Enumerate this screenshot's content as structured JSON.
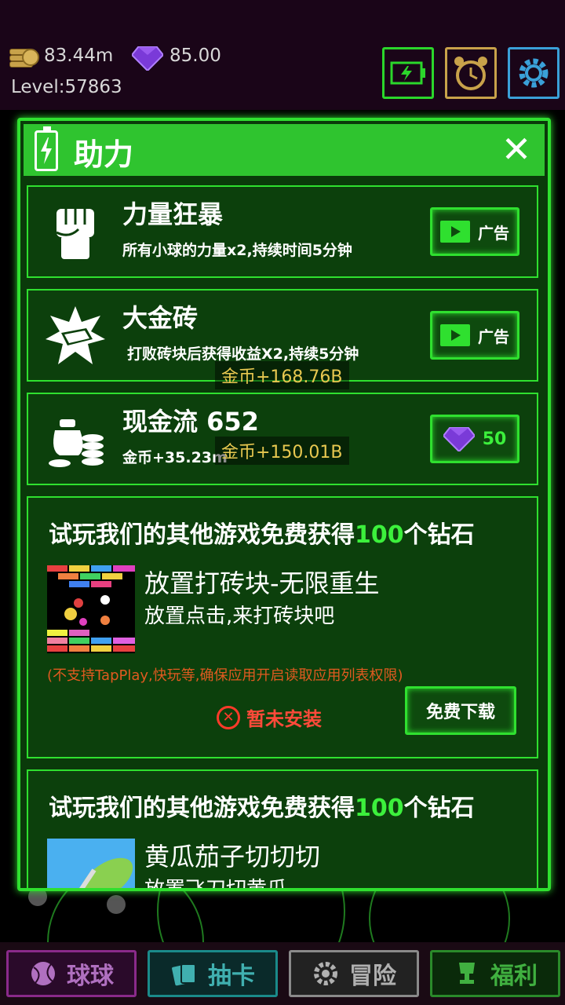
{
  "hud": {
    "coins": "83.44m",
    "gems": "85.00",
    "level": "Level:57863",
    "buttons": [
      "battery-icon",
      "alarm-clock-icon",
      "gear-icon"
    ]
  },
  "panel": {
    "title": "助力",
    "close_icon": "close-icon",
    "boosts": [
      {
        "title": "力量狂暴",
        "desc": "所有小球的力量x2,持续时间5分钟",
        "action_label": "广告",
        "icon": "fist-icon"
      },
      {
        "title": "大金砖",
        "desc": "打败砖块后获得收益X2,持续5分钟",
        "action_label": "广告",
        "icon": "gold-brick-icon"
      },
      {
        "title": "现金流 652",
        "desc": "金币+35.23m",
        "price": "50",
        "icon": "money-bag-icon"
      }
    ],
    "floating": [
      "金币+168.76B",
      "金币+150.01B"
    ],
    "promos": [
      {
        "head_pre": "试玩我们的其他游戏免费获得",
        "head_num": "100",
        "head_post": "个钻石",
        "game_name": "放置打砖块-无限重生",
        "game_sub": "放置点击,来打砖块吧",
        "note": "(不支持TapPlay,快玩等,确保应用开启读取应用列表权限)",
        "status": "暂未安装",
        "download_label": "免费下载"
      },
      {
        "head_pre": "试玩我们的其他游戏免费获得",
        "head_num": "100",
        "head_post": "个钻石",
        "game_name": "黄瓜茄子切切切",
        "game_sub": "放置飞刀切黄瓜"
      }
    ]
  },
  "nav": {
    "items": [
      {
        "label": "球球",
        "icon": "ball-icon"
      },
      {
        "label": "抽卡",
        "icon": "cards-icon"
      },
      {
        "label": "冒险",
        "icon": "gear-icon"
      },
      {
        "label": "福利",
        "icon": "trophy-icon"
      }
    ]
  },
  "colors": {
    "accent": "#2fe02f",
    "panel_bg": "#0a3a0a",
    "gold_text": "#e8c850",
    "error": "#ff4a3a"
  }
}
